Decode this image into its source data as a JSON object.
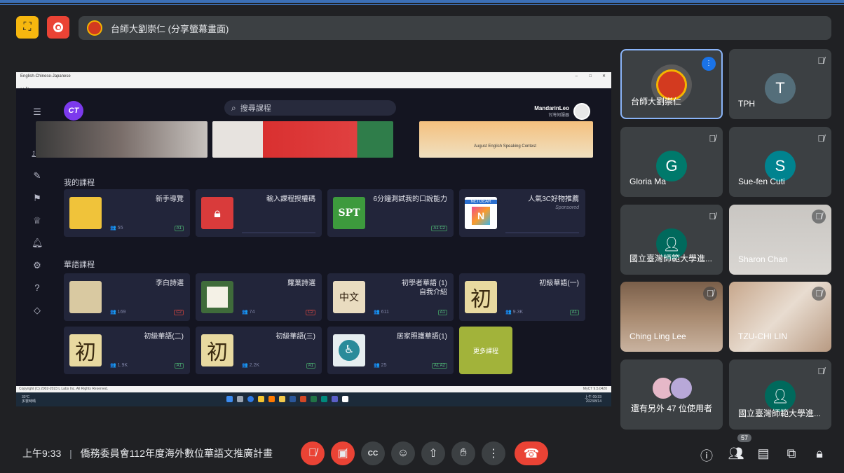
{
  "meeting": {
    "presenter_label": "台師大劉崇仁 (分享螢幕畫面)",
    "time": "上午9:33",
    "separator": "|",
    "meeting_title": "僑務委員會112年度海外數位華語文推廣計畫",
    "participant_count": "57"
  },
  "shared_screen": {
    "window_title": "English-Chinese-Japanese",
    "window_controls": [
      "–",
      "□",
      "✕"
    ],
    "search_placeholder": "搜尋課程",
    "user_name": "MandarinLeo",
    "user_role": "台灣伺服器",
    "banner_text": "August English Speaking Contest",
    "section_my_courses": "我的課程",
    "section_chinese_courses": "華語課程",
    "status_left": "Copyright (C) 2002-2023 L Labs Inc. All Rights Reserved.",
    "status_right": "MyCT 9.5.0420",
    "taskbar_weather_temp": "33°C",
    "taskbar_weather_desc": "多雲時晴",
    "taskbar_time": "上午 09:33",
    "taskbar_date": "2023/8/14",
    "sidebar_icons": [
      "menu-icon",
      "hundred-icon",
      "pencil-icon",
      "flag-icon",
      "crown-icon",
      "bell-icon",
      "settings-icon",
      "help-icon",
      "tag-icon"
    ],
    "my_courses": [
      {
        "title": "新手導覽",
        "count": "55",
        "level": "A1"
      },
      {
        "title": "輸入課程授權碼",
        "count": "",
        "level": ""
      },
      {
        "title": "6分鐘測試我的口說能力",
        "count": "",
        "level": "A1 C2"
      },
      {
        "title": "人氣3C好物推薦",
        "sub": "Sponsored",
        "count": "",
        "level": ""
      }
    ],
    "chinese_courses": [
      {
        "title": "李白詩選",
        "count": "169",
        "level": "C2"
      },
      {
        "title": "蘿葉詩選",
        "count": "74",
        "level": "C2"
      },
      {
        "title": "初學者華語 (1)\n自我介紹",
        "count": "611",
        "level": "A1"
      },
      {
        "title": "初級華語(一)",
        "count": "9.3K",
        "level": "A1"
      },
      {
        "title": "初級華語(二)",
        "count": "1.9K",
        "level": "A1"
      },
      {
        "title": "初級華語(三)",
        "count": "2.2K",
        "level": "A1"
      },
      {
        "title": "居家照護華語(1)",
        "count": "25",
        "level": "A1 A2"
      }
    ],
    "more_courses": "更多課程",
    "thumb_glyph": "初",
    "spt_text": "SPT",
    "netgear_text": "NETGEAR"
  },
  "participants": [
    {
      "name": "台師大劉崇仁",
      "initial": "",
      "muted": false,
      "active": true
    },
    {
      "name": "TPH",
      "initial": "T",
      "muted": true
    },
    {
      "name": "Gloria Ma",
      "initial": "G",
      "muted": true
    },
    {
      "name": "Sue-fen Cuti",
      "initial": "S",
      "muted": true
    },
    {
      "name": "國立臺灣師範大學進...",
      "initial": "",
      "muted": true
    },
    {
      "name": "Sharon Chan",
      "initial": "",
      "muted": true
    },
    {
      "name": "Ching Ling Lee",
      "initial": "",
      "muted": false
    },
    {
      "name": "TZU-CHI LIN",
      "initial": "",
      "muted": true
    },
    {
      "name": "還有另外 47 位使用者",
      "initial": "",
      "muted": false
    },
    {
      "name": "國立臺灣師範大學進...",
      "initial": "",
      "muted": true
    }
  ],
  "colors": {
    "background": "#202124",
    "tile": "#3c4043",
    "danger": "#ea4335",
    "active_border": "#8ab4f8",
    "avatar_teal": "#00796b",
    "avatar_blue": "#546e7a",
    "more_courses_bg": "#a2b33a"
  }
}
